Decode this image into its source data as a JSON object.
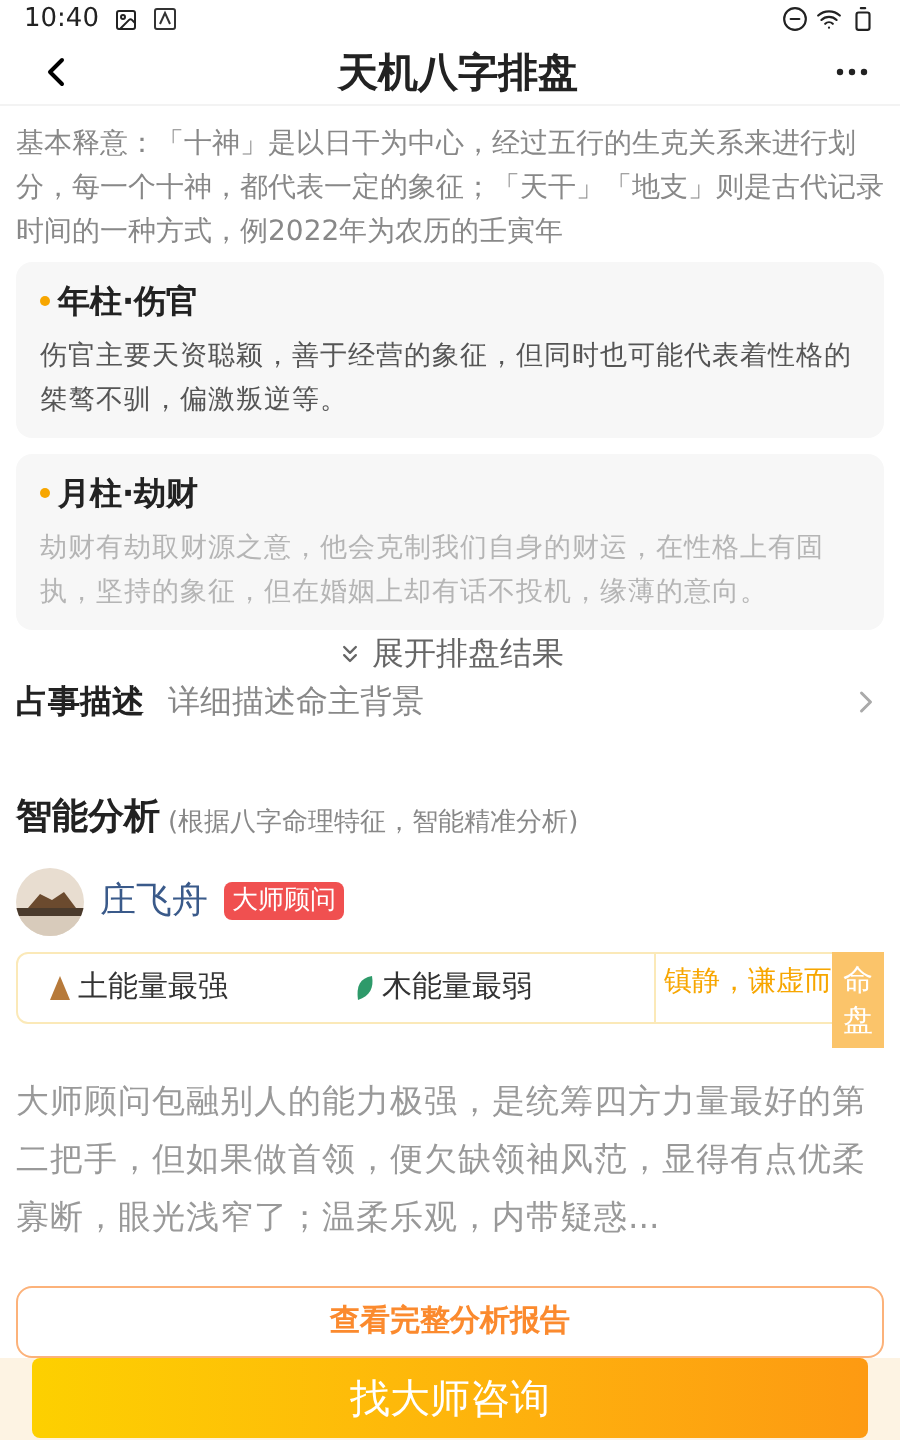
{
  "status_bar": {
    "time": "10:40"
  },
  "header": {
    "title": "天机八字排盘"
  },
  "intro": "基本释意：「十神」是以日干为中心，经过五行的生克关系来进行划分，每一个十神，都代表一定的象征；「天干」「地支」则是古代记录时间的一种方式，例2022年为农历的壬寅年",
  "pillars": [
    {
      "title": "年柱·伤官",
      "text": "伤官主要天资聪颖，善于经营的象征，但同时也可能代表着性格的桀骜不驯，偏激叛逆等。",
      "faded": false
    },
    {
      "title": "月柱·劫财",
      "text": "劫财有劫取财源之意，他会克制我们自身的财运，在性格上有固执，坚持的象征，但在婚姻上却有话不投机，缘薄的意向。",
      "faded": true
    }
  ],
  "expand_button": "展开排盘结果",
  "description_row": {
    "label": "占事描述",
    "placeholder": "详细描述命主背景"
  },
  "analysis": {
    "title": "智能分析",
    "subtitle": "(根据八字命理特征，智能精准分析)",
    "advisor": {
      "name": "庄飞舟",
      "badge": "大师顾问"
    },
    "energies": [
      {
        "kind": "earth",
        "label": "土能量最强"
      },
      {
        "kind": "wood",
        "label": "木能量最弱"
      }
    ],
    "trait": "镇静，谦虚而",
    "side_tab": "命盘",
    "summary": "大师顾问包融别人的能力极强，是统筹四方力量最好的第二把手，但如果做首领，便欠缺领袖风范，显得有点优柔寡断，眼光浅窄了；温柔乐观，内带疑惑...",
    "report_button": "查看完整分析报告"
  },
  "consult_button": "找大师咨询"
}
